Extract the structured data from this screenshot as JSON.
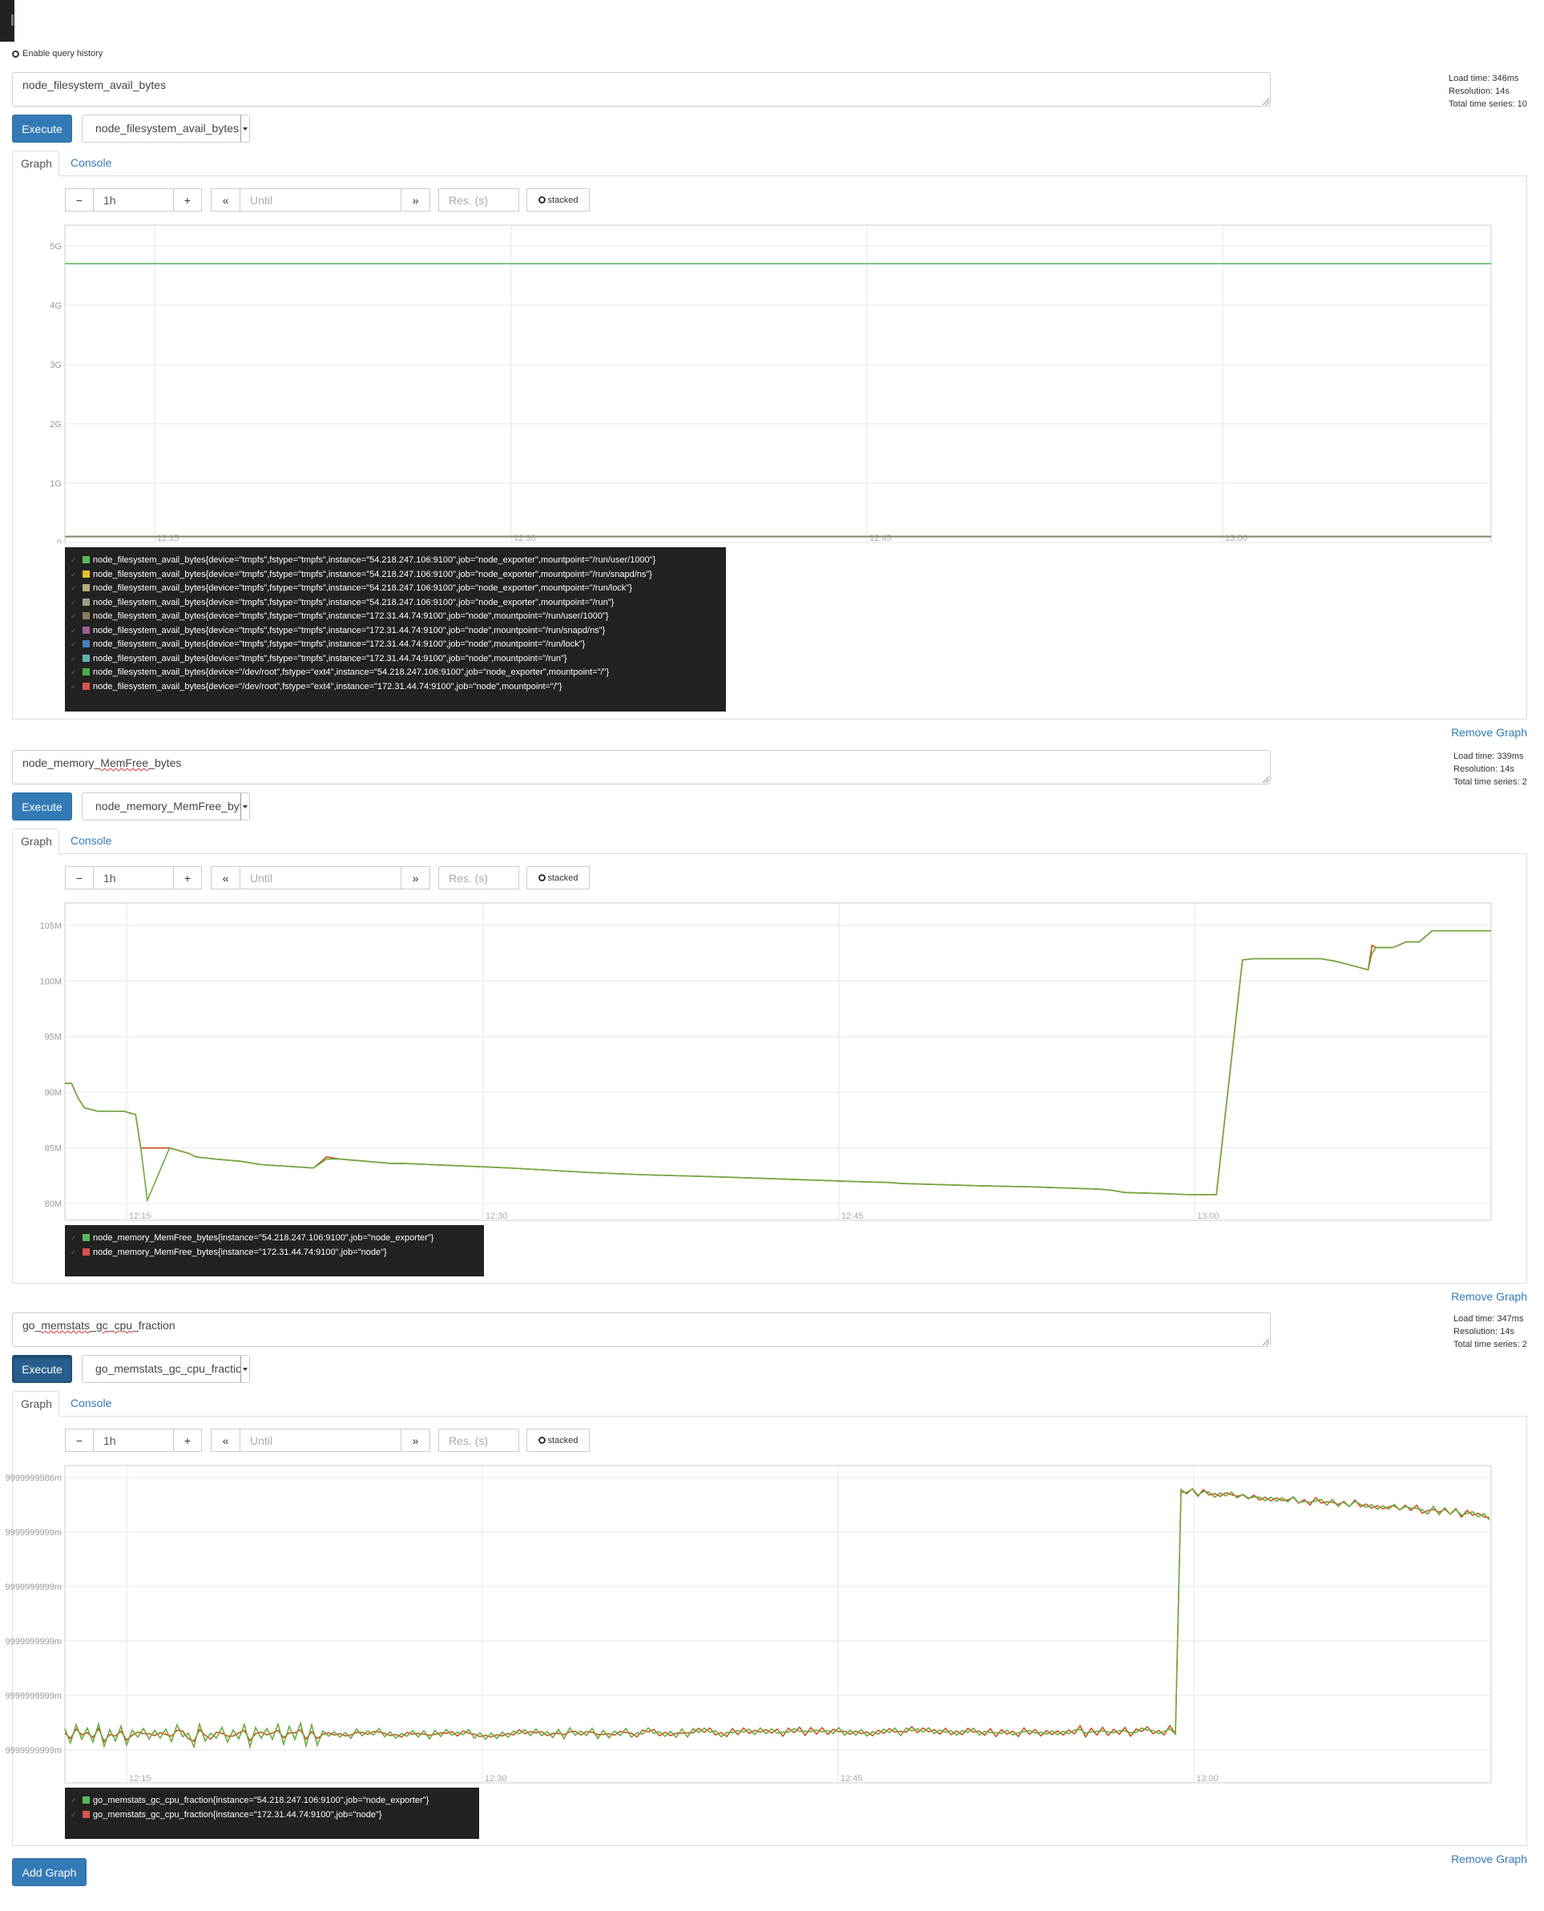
{
  "query_history_label": "Enable query history",
  "colors": {
    "primary": "#337ab7",
    "green": "#6bab40",
    "red": "#cb4b16"
  },
  "controls": {
    "minus": "−",
    "range": "1h",
    "plus": "+",
    "back": "«",
    "until_placeholder": "Until",
    "forward": "»",
    "res_placeholder": "Res. (s)",
    "stacked": "stacked"
  },
  "tabs": {
    "graph": "Graph",
    "console": "Console"
  },
  "buttons": {
    "execute": "Execute",
    "remove_graph": "Remove Graph",
    "add_graph": "Add Graph"
  },
  "panels": [
    {
      "expression": "node_filesystem_avail_bytes",
      "metric_select": "node_filesystem_avail_bytes",
      "stats": [
        "Load time: 346ms",
        "Resolution: 14s",
        "Total time series: 10"
      ],
      "legend": [
        {
          "color": "#5cb85c",
          "text": "node_filesystem_avail_bytes{device=\"tmpfs\",fstype=\"tmpfs\",instance=\"54.218.247.106:9100\",job=\"node_exporter\",mountpoint=\"/run/user/1000\"}"
        },
        {
          "color": "#e6c229",
          "text": "node_filesystem_avail_bytes{device=\"tmpfs\",fstype=\"tmpfs\",instance=\"54.218.247.106:9100\",job=\"node_exporter\",mountpoint=\"/run/snapd/ns\"}"
        },
        {
          "color": "#b5b07a",
          "text": "node_filesystem_avail_bytes{device=\"tmpfs\",fstype=\"tmpfs\",instance=\"54.218.247.106:9100\",job=\"node_exporter\",mountpoint=\"/run/lock\"}"
        },
        {
          "color": "#a0a08a",
          "text": "node_filesystem_avail_bytes{device=\"tmpfs\",fstype=\"tmpfs\",instance=\"54.218.247.106:9100\",job=\"node_exporter\",mountpoint=\"/run\"}"
        },
        {
          "color": "#8b7d5c",
          "text": "node_filesystem_avail_bytes{device=\"tmpfs\",fstype=\"tmpfs\",instance=\"172.31.44.74:9100\",job=\"node\",mountpoint=\"/run/user/1000\"}"
        },
        {
          "color": "#a05c99",
          "text": "node_filesystem_avail_bytes{device=\"tmpfs\",fstype=\"tmpfs\",instance=\"172.31.44.74:9100\",job=\"node\",mountpoint=\"/run/snapd/ns\"}"
        },
        {
          "color": "#4a7fc0",
          "text": "node_filesystem_avail_bytes{device=\"tmpfs\",fstype=\"tmpfs\",instance=\"172.31.44.74:9100\",job=\"node\",mountpoint=\"/run/lock\"}"
        },
        {
          "color": "#5fb5b0",
          "text": "node_filesystem_avail_bytes{device=\"tmpfs\",fstype=\"tmpfs\",instance=\"172.31.44.74:9100\",job=\"node\",mountpoint=\"/run\"}"
        },
        {
          "color": "#4cae4c",
          "text": "node_filesystem_avail_bytes{device=\"/dev/root\",fstype=\"ext4\",instance=\"54.218.247.106:9100\",job=\"node_exporter\",mountpoint=\"/\"}"
        },
        {
          "color": "#d9534f",
          "text": "node_filesystem_avail_bytes{device=\"/dev/root\",fstype=\"ext4\",instance=\"172.31.44.74:9100\",job=\"node\",mountpoint=\"/\"}"
        }
      ]
    },
    {
      "expression_parts": [
        "node_memory_",
        "MemFree",
        "_bytes"
      ],
      "metric_select": "node_memory_MemFree_bytes",
      "stats": [
        "Load time: 339ms",
        "Resolution: 14s",
        "Total time series: 2"
      ],
      "legend": [
        {
          "color": "#5cb85c",
          "text": "node_memory_MemFree_bytes{instance=\"54.218.247.106:9100\",job=\"node_exporter\"}"
        },
        {
          "color": "#d9534f",
          "text": "node_memory_MemFree_bytes{instance=\"172.31.44.74:9100\",job=\"node\"}"
        }
      ]
    },
    {
      "expression_parts": [
        "go_",
        "memstats",
        "_",
        "gc",
        "_",
        "cpu",
        "_fraction"
      ],
      "metric_select": "go_memstats_gc_cpu_fraction",
      "stats": [
        "Load time: 347ms",
        "Resolution: 14s",
        "Total time series: 2"
      ],
      "legend": [
        {
          "color": "#5cb85c",
          "text": "go_memstats_gc_cpu_fraction{instance=\"54.218.247.106:9100\",job=\"node_exporter\"}"
        },
        {
          "color": "#d9534f",
          "text": "go_memstats_gc_cpu_fraction{instance=\"172.31.44.74:9100\",job=\"node\"}"
        }
      ]
    }
  ],
  "chart_data": [
    {
      "type": "line",
      "x_ticks": [
        "12:15",
        "12:30",
        "12:45",
        "13:00"
      ],
      "y_ticks": [
        "0",
        "1G",
        "2G",
        "3G",
        "4G",
        "5G"
      ],
      "ylim": [
        0,
        5.35
      ],
      "y_unit": "G",
      "grid": true,
      "series": [
        {
          "name": "node_filesystem_avail_bytes{device=\"/dev/root\",fstype=\"ext4\",instance=\"54.218.247.106:9100\",job=\"node_exporter\",mountpoint=\"/\"}",
          "values": [
            4.7,
            4.7
          ]
        },
        {
          "name": "node_filesystem_avail_bytes{device=\"/dev/root\",fstype=\"ext4\",instance=\"172.31.44.74:9100\",job=\"node\",mountpoint=\"/\"}",
          "values": [
            0.1,
            0.1
          ]
        },
        {
          "name": "node_filesystem_avail_bytes{device=\"tmpfs\",fstype=\"tmpfs\",instance=\"54.218.247.106:9100\",job=\"node_exporter\",mountpoint=\"/run\"}",
          "values": [
            0.1,
            0.1
          ]
        }
      ]
    },
    {
      "type": "line",
      "x_ticks": [
        "12:15",
        "12:30",
        "12:45",
        "13:00"
      ],
      "y_ticks": [
        "80M",
        "85M",
        "90M",
        "95M",
        "100M",
        "105M"
      ],
      "ylim": [
        78.5,
        107
      ],
      "y_unit": "M",
      "grid": true,
      "series": [
        {
          "name": "node_memory_MemFree_bytes{instance=\"54.218.247.106:9100\",job=\"node_exporter\"}",
          "x": [
            0,
            0.5,
            1,
            1.5,
            2.5,
            4.5,
            5.4,
            5.8,
            6.3,
            8,
            9.5,
            10,
            11.5,
            13.5,
            15,
            19,
            20,
            21,
            25,
            26,
            34,
            37,
            40,
            44,
            50,
            55,
            60,
            63,
            64,
            70,
            74,
            79,
            80,
            81,
            84,
            86,
            88,
            90,
            90.9,
            91.3,
            92,
            96,
            97,
            98,
            99.6,
            99.9,
            100.2,
            101.5,
            102.5,
            103.5,
            104.5,
            105.2,
            106,
            109
          ],
          "values": [
            90.8,
            90.8,
            89.5,
            88.6,
            88.3,
            88.3,
            88,
            85,
            80.3,
            85,
            84.5,
            84.2,
            84,
            83.8,
            83.5,
            83.2,
            84,
            84,
            83.6,
            83.6,
            83.2,
            83,
            82.8,
            82.6,
            82.4,
            82.2,
            82,
            81.9,
            81.8,
            81.6,
            81.5,
            81.3,
            81.2,
            81,
            80.9,
            80.8,
            80.8,
            101.9,
            102,
            102,
            102,
            102,
            101.8,
            101.5,
            101,
            102.5,
            103,
            103,
            103.5,
            103.5,
            104.5,
            104.5,
            104.5,
            104.5
          ]
        },
        {
          "name": "node_memory_MemFree_bytes{instance=\"172.31.44.74:9100\",job=\"node\"}",
          "x": [
            0,
            0.5,
            1,
            1.5,
            2.5,
            4.5,
            5.4,
            5.8,
            6.3,
            8,
            9.5,
            10,
            11.5,
            13.5,
            15,
            19,
            20,
            21,
            25,
            26,
            34,
            37,
            40,
            44,
            50,
            55,
            60,
            63,
            64,
            70,
            74,
            79,
            80,
            81,
            84,
            86,
            88,
            90,
            90.9,
            91.3,
            92,
            96,
            97,
            98,
            99.6,
            99.9,
            100.2,
            101.5,
            102.5,
            103.5,
            104.5,
            105.2,
            106,
            109
          ],
          "values": [
            90.8,
            90.8,
            89.5,
            88.6,
            88.3,
            88.3,
            88,
            85,
            85,
            85,
            84.5,
            84.2,
            84,
            83.8,
            83.5,
            83.2,
            84.2,
            84,
            83.6,
            83.6,
            83.2,
            83,
            82.8,
            82.6,
            82.4,
            82.2,
            82,
            81.9,
            81.8,
            81.6,
            81.5,
            81.3,
            81.2,
            81,
            80.9,
            80.8,
            80.8,
            101.9,
            102,
            102,
            102,
            102,
            101.8,
            101.5,
            101,
            103.2,
            103,
            103,
            103.5,
            103.5,
            104.5,
            104.5,
            104.5,
            104.5
          ]
        }
      ]
    },
    {
      "type": "line",
      "x_ticks": [
        "12:15",
        "12:30",
        "12:45",
        "13:00"
      ],
      "y_ticks": [
        "9999999999m",
        "9999999999m",
        "9999999999m",
        "9999999999m",
        "9999999999m",
        "9999999986m"
      ],
      "ylim": [
        0,
        5.35
      ],
      "grid": true,
      "series": [
        {
          "name": "go_memstats_gc_cpu_fraction{instance=\"54.218.247.106:9100\",job=\"node_exporter\"}"
        },
        {
          "name": "go_memstats_gc_cpu_fraction{instance=\"172.31.44.74:9100\",job=\"node\"}"
        }
      ]
    }
  ]
}
